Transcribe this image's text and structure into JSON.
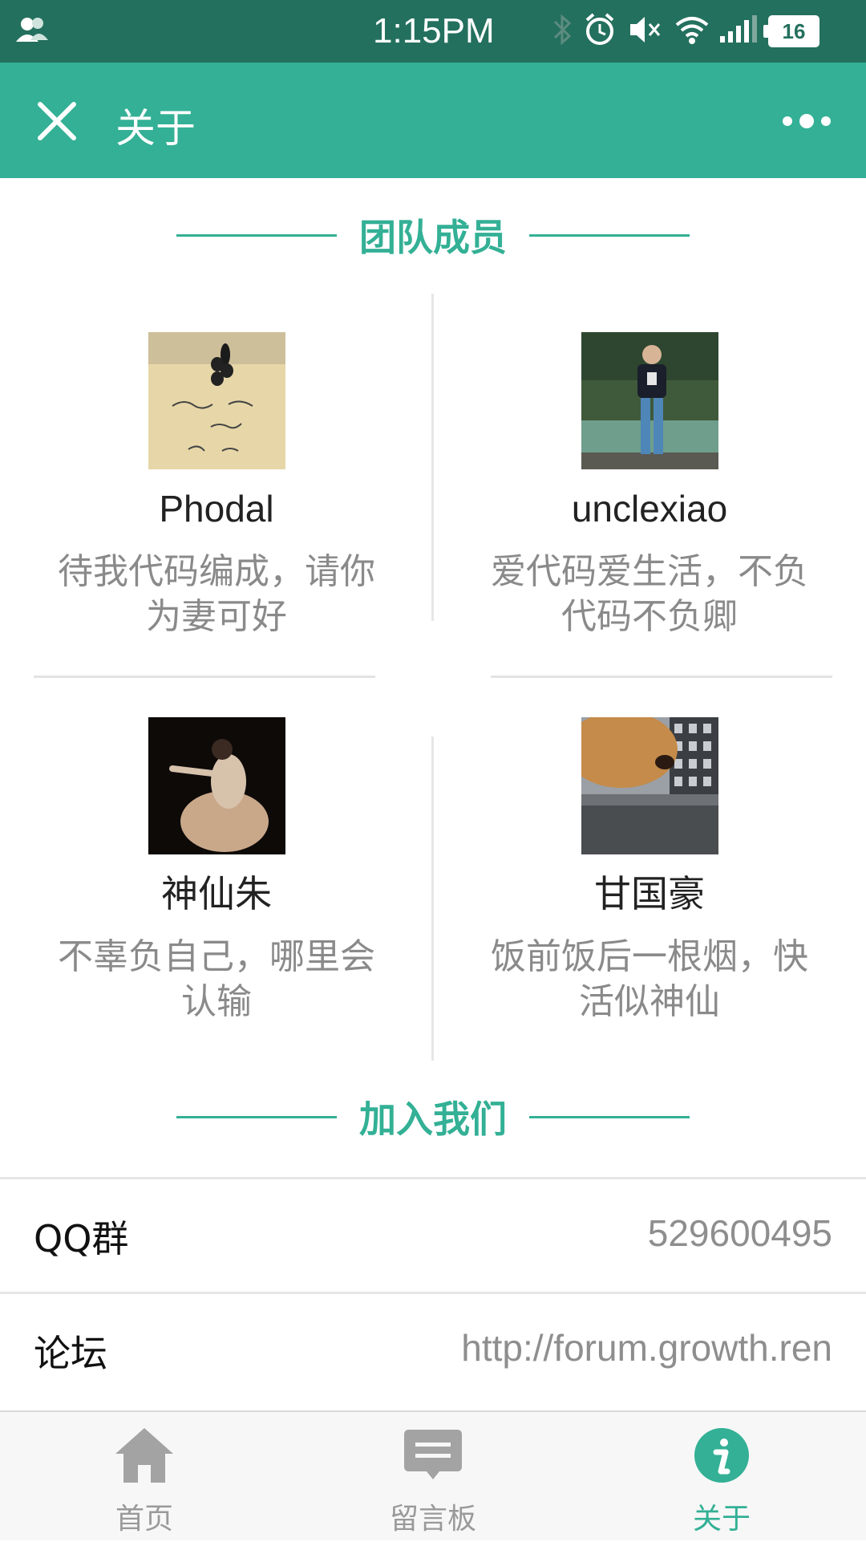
{
  "status_bar": {
    "time": "1:15PM",
    "battery": "16",
    "icons": [
      "user-icon",
      "bluetooth-icon",
      "alarm-icon",
      "mute-icon",
      "wifi-icon",
      "signal-icon",
      "battery-icon"
    ]
  },
  "app_bar": {
    "title": "关于"
  },
  "team_section": {
    "title": "团队成员"
  },
  "members": [
    {
      "name": "Phodal",
      "motto": "待我代码编成，请你为妻可好"
    },
    {
      "name": "unclexiao",
      "motto": "爱代码爱生活，不负代码不负卿"
    },
    {
      "name": "神仙朱",
      "motto": "不辜负自己，哪里会认输"
    },
    {
      "name": "甘国豪",
      "motto": "饭前饭后一根烟，快活似神仙"
    }
  ],
  "join_section": {
    "title": "加入我们"
  },
  "info_rows": [
    {
      "key": "QQ群",
      "value": "529600495"
    },
    {
      "key": "论坛",
      "value": "http://forum.growth.ren"
    }
  ],
  "tabbar": {
    "tabs": [
      {
        "label": "首页",
        "icon": "home-icon",
        "active": false
      },
      {
        "label": "留言板",
        "icon": "message-board-icon",
        "active": false
      },
      {
        "label": "关于",
        "icon": "info-icon",
        "active": true
      }
    ]
  },
  "colors": {
    "status_bar": "#24705e",
    "accent": "#33b095",
    "muted_text": "#8a8a8a",
    "tab_inactive": "#9a9a9a"
  }
}
